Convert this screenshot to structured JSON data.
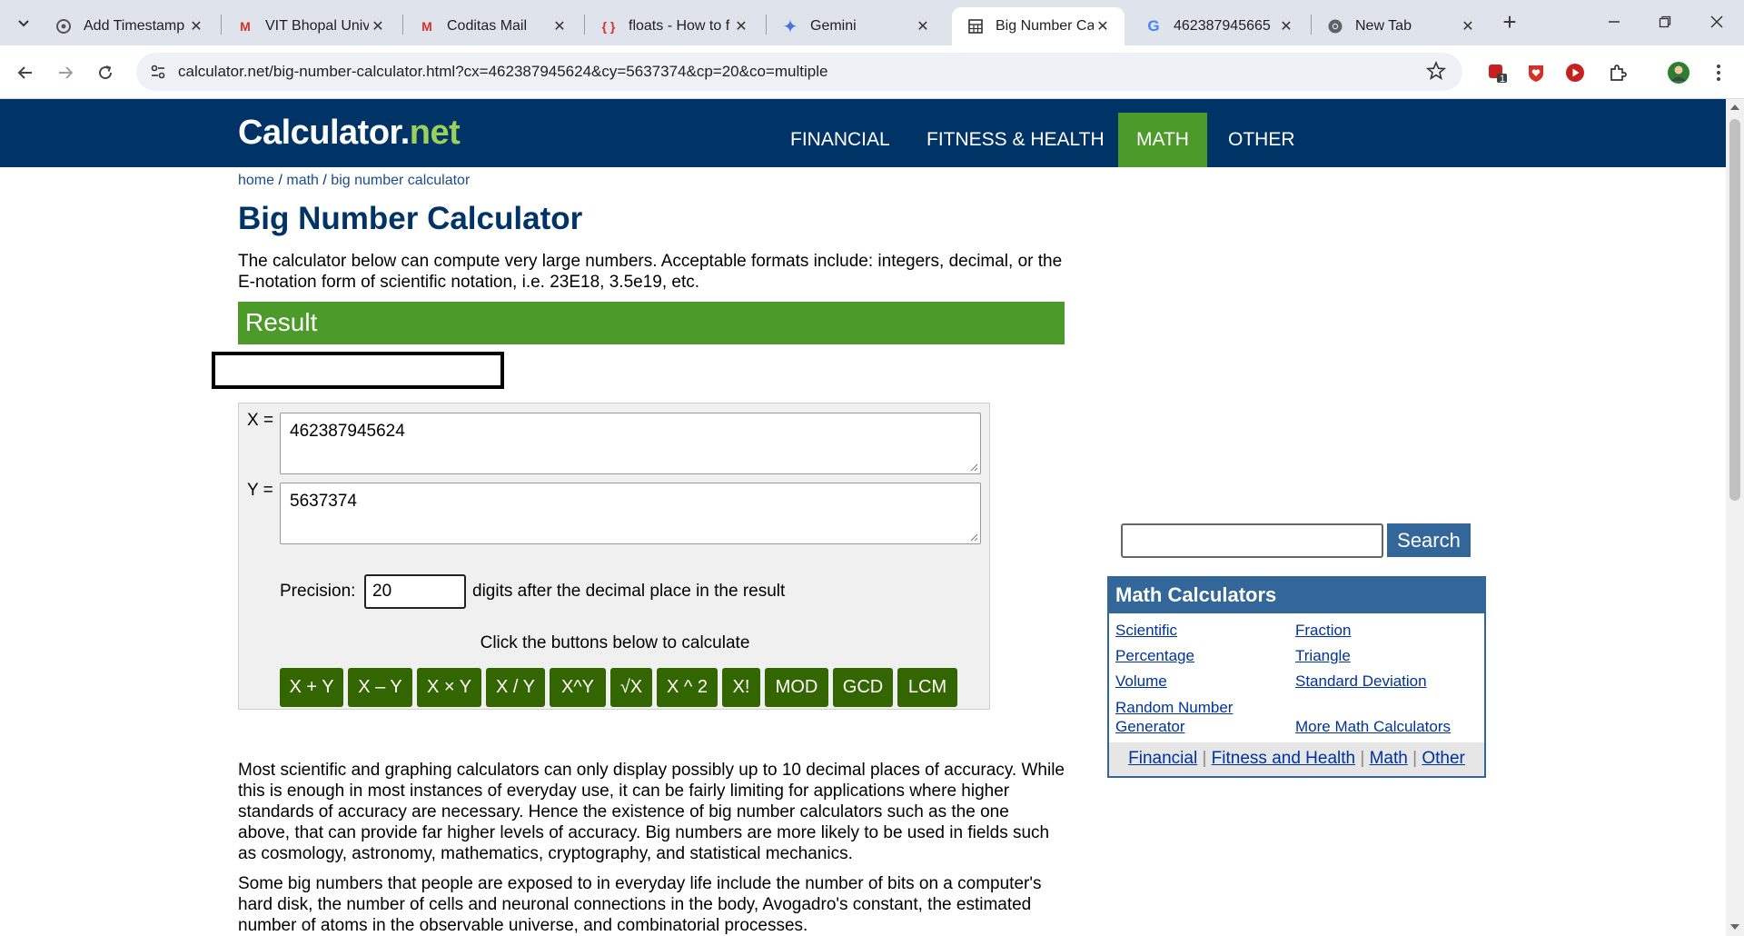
{
  "browser": {
    "tabs": [
      {
        "title": "Add Timestamp",
        "icon": "tab-generic-icon",
        "active": false
      },
      {
        "title": "VIT Bhopal Unive",
        "icon": "gmail-icon",
        "active": false
      },
      {
        "title": "Coditas Mail",
        "icon": "gmail-icon",
        "active": false
      },
      {
        "title": "floats - How to f",
        "icon": "stackoverflow-icon",
        "active": false
      },
      {
        "title": "Gemini",
        "icon": "gemini-icon",
        "active": false
      },
      {
        "title": "Big Number Calc",
        "icon": "calculator-icon",
        "active": true
      },
      {
        "title": "462387945665",
        "icon": "google-icon",
        "active": false
      },
      {
        "title": "New Tab",
        "icon": "chrome-icon",
        "active": false
      }
    ],
    "url": "calculator.net/big-number-calculator.html?cx=462387945624&cy=5637374&cp=20&co=multiple",
    "extension_badge": "1"
  },
  "site": {
    "logo_main": "Calculator",
    "logo_dot": ".",
    "logo_net": "net",
    "nav": [
      "FINANCIAL",
      "FITNESS & HEALTH",
      "MATH",
      "OTHER"
    ],
    "active_nav": "MATH"
  },
  "breadcrumb": {
    "home": "home",
    "sep": " / ",
    "math": "math",
    "current": "big number calculator"
  },
  "title": "Big Number Calculator",
  "intro": "The calculator below can compute very large numbers. Acceptable formats include: integers, decimal, or the E-notation form of scientific notation, i.e. 23E18, 3.5e19, etc.",
  "result_heading": "Result",
  "calculator": {
    "x_label": "X =",
    "x_value": "462387945624",
    "y_label": "Y =",
    "y_value": "5637374",
    "precision_label": "Precision:",
    "precision_value": "20",
    "precision_suffix": "digits after the decimal place in the result",
    "instruction": "Click the buttons below to calculate",
    "buttons": [
      "X + Y",
      "X – Y",
      "X × Y",
      "X / Y",
      "X^Y",
      "√X",
      "X ^ 2",
      "X!",
      "MOD",
      "GCD",
      "LCM"
    ]
  },
  "paragraphs": [
    "Most scientific and graphing calculators can only display possibly up to 10 decimal places of accuracy. While this is enough in most instances of everyday use, it can be fairly limiting for applications where higher standards of accuracy are necessary. Hence the existence of big number calculators such as the one above, that can provide far higher levels of accuracy. Big numbers are more likely to be used in fields such as cosmology, astronomy, mathematics, cryptography, and statistical mechanics.",
    "Some big numbers that people are exposed to in everyday life include the number of bits on a computer's hard disk, the number of cells and neuronal connections in the body, Avogadro's constant, the estimated number of atoms in the observable universe, and combinatorial processes."
  ],
  "sidebar": {
    "search_button": "Search",
    "math_title": "Math Calculators",
    "links": [
      "Scientific",
      "Fraction",
      "Percentage",
      "Triangle",
      "Volume",
      "Standard Deviation",
      "Random Number Generator",
      "More Math Calculators"
    ],
    "footer_links": [
      "Financial",
      "Fitness and Health",
      "Math",
      "Other"
    ],
    "footer_sep": "|"
  },
  "colors": {
    "header": "#003366",
    "accent_green": "#4c9a2a",
    "button_green": "#336600",
    "sidebar_blue": "#336699"
  }
}
